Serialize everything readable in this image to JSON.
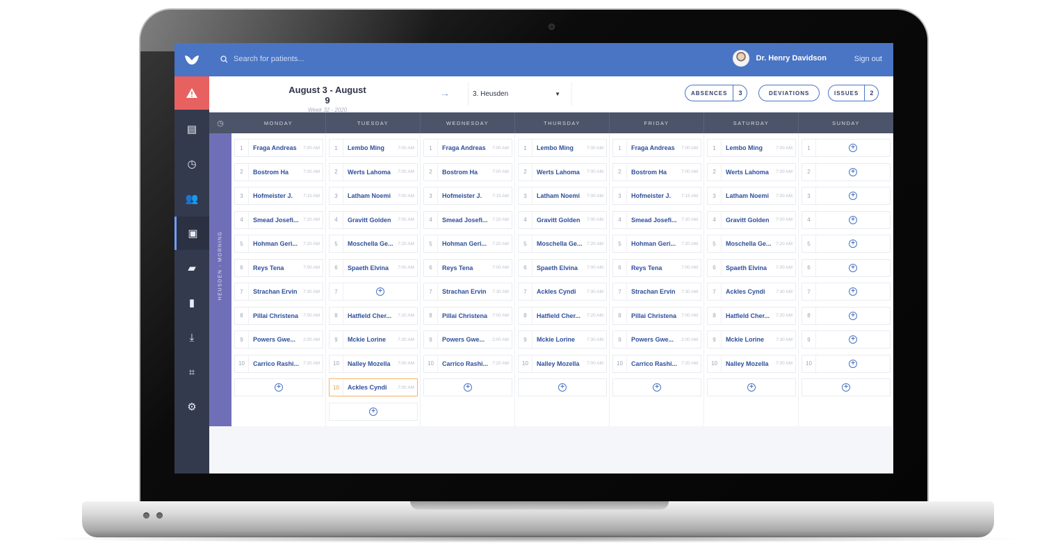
{
  "app": {
    "search_placeholder": "Search for patients...",
    "user_name": "Dr. Henry Davidson",
    "sign_out": "Sign out"
  },
  "sidebar": {
    "items": [
      {
        "icon": "id-card-icon",
        "glyph": "▤"
      },
      {
        "icon": "clock-icon",
        "glyph": "◷"
      },
      {
        "icon": "people-icon",
        "glyph": "👥"
      },
      {
        "icon": "calendar-icon",
        "glyph": "▣"
      },
      {
        "icon": "chat-icon",
        "glyph": "▰"
      },
      {
        "icon": "document-icon",
        "glyph": "▮"
      },
      {
        "icon": "download-icon",
        "glyph": "⤓"
      },
      {
        "icon": "puzzle-icon",
        "glyph": "⌗"
      },
      {
        "icon": "settings-icon",
        "glyph": "⚙"
      }
    ]
  },
  "header": {
    "week_title": "August 3 - August 9",
    "week_sub": "Week 32 - 2020",
    "location": "3. Heusden",
    "absences_label": "ABSENCES",
    "absences_count": "3",
    "deviations_label": "DEVIATIONS",
    "issues_label": "ISSUES",
    "issues_count": "2"
  },
  "band_label": "HEUSDEN - MORNING",
  "days": [
    "MONDAY",
    "TUESDAY",
    "WEDNESDAY",
    "THURSDAY",
    "FRIDAY",
    "SATURDAY",
    "SUNDAY"
  ],
  "schedule": {
    "mon": [
      {
        "n": "1",
        "name": "Fraga Andreas",
        "time": "7:00 AM"
      },
      {
        "n": "2",
        "name": "Bostrom Ha",
        "time": "7:00 AM"
      },
      {
        "n": "3",
        "name": "Hofmeister J.",
        "time": "7:15 AM"
      },
      {
        "n": "4",
        "name": "Smead Josefi...",
        "time": "7:20 AM"
      },
      {
        "n": "5",
        "name": "Hohman Geri...",
        "time": "7:20 AM"
      },
      {
        "n": "6",
        "name": "Reys Tena",
        "time": "7:00 AM"
      },
      {
        "n": "7",
        "name": "Strachan Ervin",
        "time": "7:30 AM"
      },
      {
        "n": "8",
        "name": "Pillai Christena",
        "time": "7:00 AM"
      },
      {
        "n": "9",
        "name": "Powers Gwe...",
        "time": "2:00 AM"
      },
      {
        "n": "10",
        "name": "Carrico Rashi...",
        "time": "7:20 AM"
      }
    ],
    "tue": [
      {
        "n": "1",
        "name": "Lembo Ming",
        "time": "7:00 AM"
      },
      {
        "n": "2",
        "name": "Werts Lahoma",
        "time": "7:00 AM"
      },
      {
        "n": "3",
        "name": "Latham Noemi",
        "time": "7:00 AM"
      },
      {
        "n": "4",
        "name": "Gravitt Golden",
        "time": "7:00 AM"
      },
      {
        "n": "5",
        "name": "Moschella Ge...",
        "time": "7:20 AM"
      },
      {
        "n": "6",
        "name": "Spaeth Elvina",
        "time": "7:00 AM"
      },
      {
        "n": "7",
        "name": "",
        "time": ""
      },
      {
        "n": "8",
        "name": "Hatfield Cher...",
        "time": "7:20 AM"
      },
      {
        "n": "9",
        "name": "Mckie Lorine",
        "time": "7:30 AM"
      },
      {
        "n": "10",
        "name": "Nalley Mozella",
        "time": "7:00 AM"
      },
      {
        "n": "10",
        "name": "Ackles Cyndi",
        "time": "7:00 AM"
      }
    ],
    "wed": [
      {
        "n": "1",
        "name": "Fraga Andreas",
        "time": "7:00 AM"
      },
      {
        "n": "2",
        "name": "Bostrom Ha",
        "time": "7:00 AM"
      },
      {
        "n": "3",
        "name": "Hofmeister J.",
        "time": "7:15 AM"
      },
      {
        "n": "4",
        "name": "Smead Josefi...",
        "time": "7:20 AM"
      },
      {
        "n": "5",
        "name": "Hohman Geri...",
        "time": "7:20 AM"
      },
      {
        "n": "6",
        "name": "Reys Tena",
        "time": "7:00 AM"
      },
      {
        "n": "7",
        "name": "Strachan Ervin",
        "time": "7:30 AM"
      },
      {
        "n": "8",
        "name": "Pillai Christena",
        "time": "7:00 AM"
      },
      {
        "n": "9",
        "name": "Powers Gwe...",
        "time": "2:00 AM"
      },
      {
        "n": "10",
        "name": "Carrico Rashi...",
        "time": "7:20 AM"
      }
    ],
    "thu": [
      {
        "n": "1",
        "name": "Lembo Ming",
        "time": "7:00 AM"
      },
      {
        "n": "2",
        "name": "Werts Lahoma",
        "time": "7:00 AM"
      },
      {
        "n": "3",
        "name": "Latham Noemi",
        "time": "7:00 AM"
      },
      {
        "n": "4",
        "name": "Gravitt Golden",
        "time": "7:00 AM"
      },
      {
        "n": "5",
        "name": "Moschella Ge...",
        "time": "7:20 AM"
      },
      {
        "n": "6",
        "name": "Spaeth Elvina",
        "time": "7:00 AM"
      },
      {
        "n": "7",
        "name": "Ackles Cyndi",
        "time": "7:30 AM"
      },
      {
        "n": "8",
        "name": "Hatfield Cher...",
        "time": "7:20 AM"
      },
      {
        "n": "9",
        "name": "Mckie Lorine",
        "time": "7:30 AM"
      },
      {
        "n": "10",
        "name": "Nalley Mozella",
        "time": "7:00 AM"
      }
    ],
    "fri": [
      {
        "n": "1",
        "name": "Fraga Andreas",
        "time": "7:00 AM"
      },
      {
        "n": "2",
        "name": "Bostrom Ha",
        "time": "7:00 AM"
      },
      {
        "n": "3",
        "name": "Hofmeister J.",
        "time": "7:15 AM"
      },
      {
        "n": "4",
        "name": "Smead Josefi...",
        "time": "7:20 AM"
      },
      {
        "n": "5",
        "name": "Hohman Geri...",
        "time": "7:20 AM"
      },
      {
        "n": "6",
        "name": "Reys Tena",
        "time": "7:00 AM"
      },
      {
        "n": "7",
        "name": "Strachan Ervin",
        "time": "7:30 AM"
      },
      {
        "n": "8",
        "name": "Pillai Christena",
        "time": "7:00 AM"
      },
      {
        "n": "9",
        "name": "Powers Gwe...",
        "time": "2:00 AM"
      },
      {
        "n": "10",
        "name": "Carrico Rashi...",
        "time": "7:20 AM"
      }
    ],
    "sat": [
      {
        "n": "1",
        "name": "Lembo Ming",
        "time": "7:00 AM"
      },
      {
        "n": "2",
        "name": "Werts Lahoma",
        "time": "7:00 AM"
      },
      {
        "n": "3",
        "name": "Latham Noemi",
        "time": "7:00 AM"
      },
      {
        "n": "4",
        "name": "Gravitt Golden",
        "time": "7:00 AM"
      },
      {
        "n": "5",
        "name": "Moschella Ge...",
        "time": "7:20 AM"
      },
      {
        "n": "6",
        "name": "Spaeth Elvina",
        "time": "7:00 AM"
      },
      {
        "n": "7",
        "name": "Ackles Cyndi",
        "time": "7:30 AM"
      },
      {
        "n": "8",
        "name": "Hatfield Cher...",
        "time": "7:20 AM"
      },
      {
        "n": "9",
        "name": "Mckie Lorine",
        "time": "7:30 AM"
      },
      {
        "n": "10",
        "name": "Nalley Mozella",
        "time": "7:00 AM"
      }
    ],
    "sun": [
      {
        "n": "1"
      },
      {
        "n": "2"
      },
      {
        "n": "3"
      },
      {
        "n": "4"
      },
      {
        "n": "5"
      },
      {
        "n": "6"
      },
      {
        "n": "7"
      },
      {
        "n": "8"
      },
      {
        "n": "9"
      },
      {
        "n": "10"
      }
    ]
  }
}
